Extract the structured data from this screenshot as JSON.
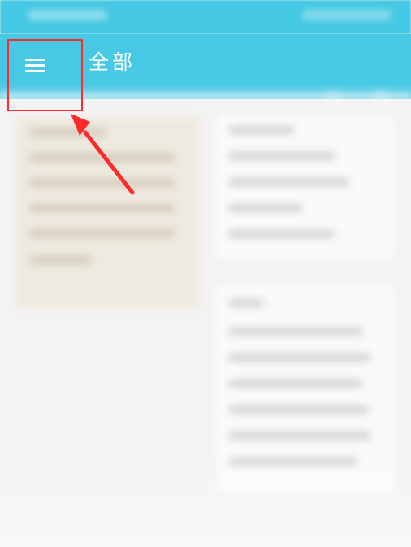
{
  "header": {
    "title": "全部"
  },
  "icons": {
    "menu": "hamburger-menu-icon",
    "annotation_arrow": "red-arrow-icon"
  },
  "colors": {
    "app_bar": "#47c8e4",
    "annotation": "#ff2a2a",
    "left_card": "#efeadf",
    "background": "#f3f3f3"
  }
}
